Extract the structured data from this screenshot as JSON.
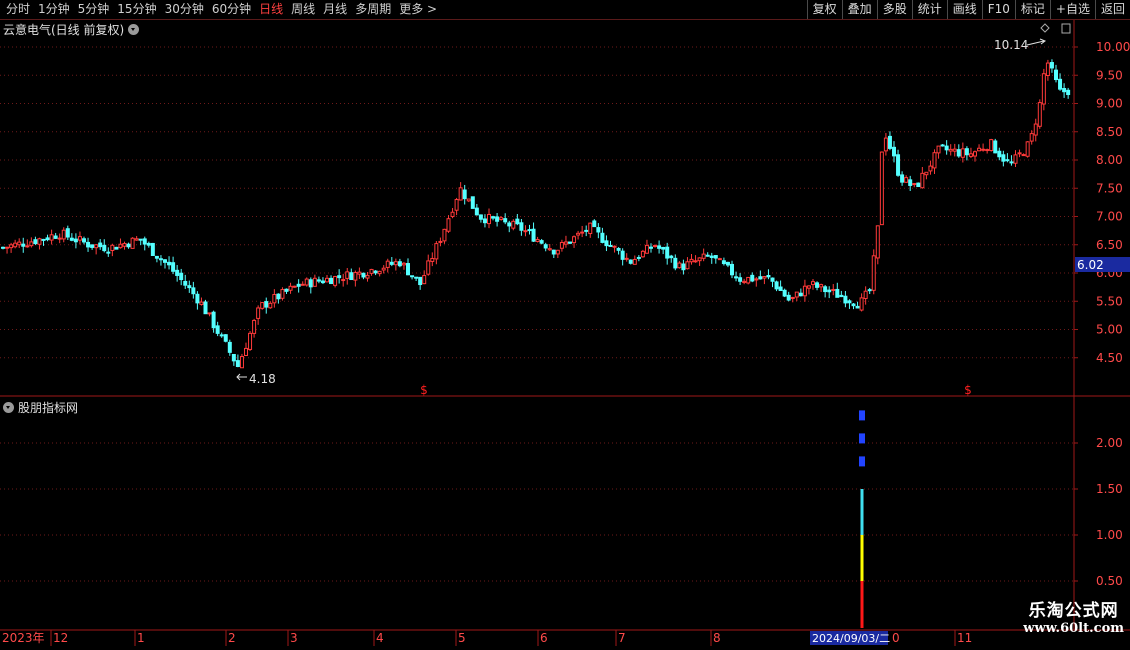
{
  "toolbar": {
    "periods": [
      "分时",
      "1分钟",
      "5分钟",
      "15分钟",
      "30分钟",
      "60分钟",
      "日线",
      "周线",
      "月线",
      "多周期",
      "更多"
    ],
    "active_period": "日线",
    "more_arrow": ">",
    "buttons": [
      "复权",
      "叠加",
      "多股",
      "统计",
      "画线",
      "F10",
      "标记",
      "+自选",
      "返回"
    ]
  },
  "main_chart": {
    "title": "云意电气(日线 前复权)",
    "high_label": "10.14",
    "low_label": "4.18",
    "current_price": "6.02",
    "event_marker": "$",
    "price_axis": [
      "10.00",
      "9.50",
      "9.00",
      "8.50",
      "8.00",
      "7.50",
      "7.00",
      "6.50",
      "6.00",
      "5.50",
      "5.00",
      "4.50"
    ]
  },
  "indicator": {
    "title": "股朋指标网",
    "value_axis": [
      "2.00",
      "1.50",
      "1.00",
      "0.50"
    ]
  },
  "time_axis": {
    "labels": [
      "2023年",
      "12",
      "1",
      "2",
      "3",
      "4",
      "5",
      "6",
      "7",
      "8",
      "0",
      "11"
    ],
    "cursor_date": "2024/09/03/二"
  },
  "watermark": {
    "line1": "乐淘公式网",
    "line2": "www.60lt.com"
  },
  "colors": {
    "up": "#ff3a3a",
    "down": "#54ffff",
    "grid": "#6e1a1a",
    "axis": "#a01818",
    "current_price_bg": "#1a2aa0",
    "signal_blue": "#2244ff",
    "signal_cyan": "#40e0f0",
    "signal_yellow": "#ffff00",
    "signal_red": "#ff1818"
  }
}
